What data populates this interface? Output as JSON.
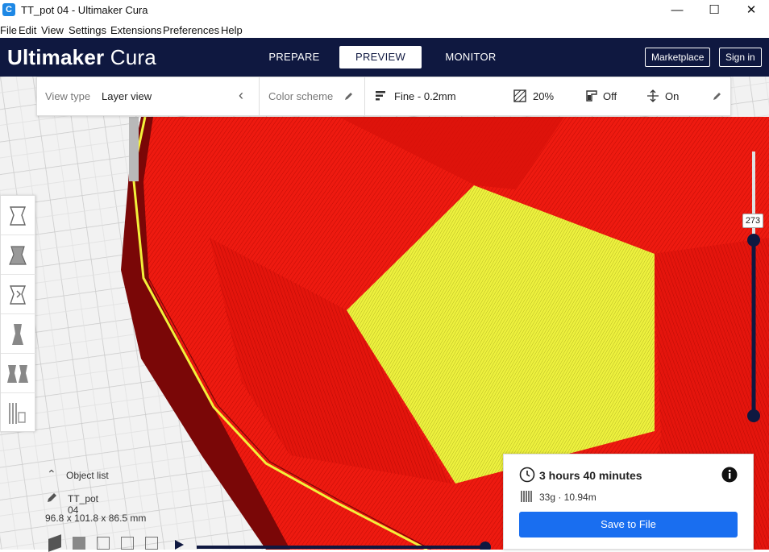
{
  "window": {
    "title": "TT_pot 04 - Ultimaker Cura",
    "app_icon_glyph": "C",
    "minimize": "—",
    "maximize": "☐",
    "close": "✕"
  },
  "menu": [
    "File",
    "Edit",
    "View",
    "Settings",
    "Extensions",
    "Preferences",
    "Help"
  ],
  "header": {
    "brand_bold": "Ultimaker",
    "brand_light": "Cura",
    "tabs": [
      "PREPARE",
      "PREVIEW",
      "MONITOR"
    ],
    "active_tab": "PREVIEW",
    "marketplace": "Marketplace",
    "signin": "Sign in",
    "bg_color": "#0f1840"
  },
  "toolbar": {
    "view_type_label": "View type",
    "view_type_value": "Layer view",
    "color_scheme_label": "Color scheme",
    "profile": "Fine - 0.2mm",
    "infill": "20%",
    "support": "Off",
    "adhesion": "On"
  },
  "left_tools": [
    "move-tool-icon",
    "scale-tool-icon",
    "rotate-tool-icon",
    "mirror-tool-icon",
    "per-model-settings-icon",
    "support-blocker-icon"
  ],
  "layer_slider": {
    "current_layer": "273",
    "level": 0.33
  },
  "object": {
    "list_label": "Object list",
    "name": "TT_pot 04",
    "dimensions": "96.8 x 101.8 x 86.5 mm"
  },
  "print_info": {
    "time": "3 hours 40 minutes",
    "material": "33g · 10.94m",
    "save_label": "Save to File",
    "accent": "#196ef0"
  },
  "colors": {
    "model_red": "#e8150d",
    "model_dark": "#8a0a0a",
    "infill_yellow": "#e9f23c"
  }
}
